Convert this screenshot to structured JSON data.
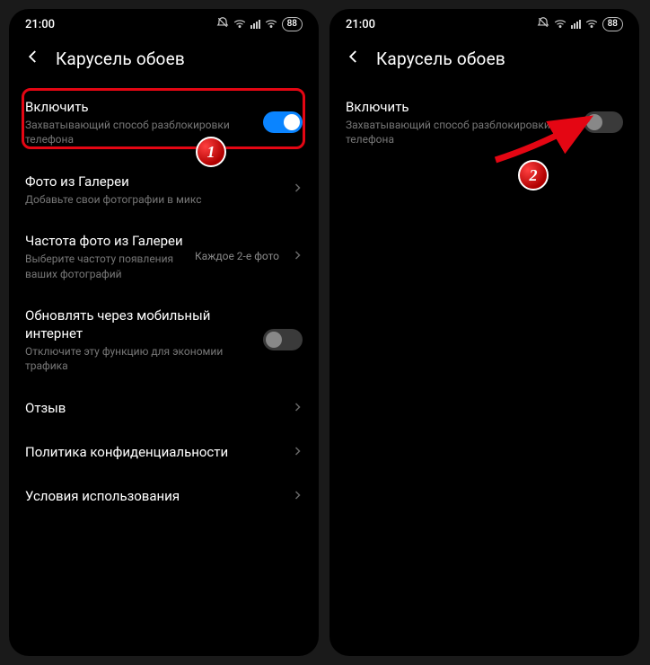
{
  "statusbar": {
    "time": "21:00",
    "battery": "88"
  },
  "header": {
    "title": "Карусель обоев"
  },
  "left": {
    "enable": {
      "title": "Включить",
      "sub": "Захватывающий способ разблокировки телефона"
    },
    "gallery": {
      "title": "Фото из Галереи",
      "sub": "Добавьте свои фотографии в микс"
    },
    "freq": {
      "title": "Частота фото из Галереи",
      "sub": "Выберите частоту появления ваших фотографий",
      "value": "Каждое 2-е фото"
    },
    "mobile": {
      "title": "Обновлять через мобильный интернет",
      "sub": "Отключите эту функцию для экономии трафика"
    },
    "review": {
      "title": "Отзыв"
    },
    "privacy": {
      "title": "Политика конфиденциальности"
    },
    "terms": {
      "title": "Условия использования"
    }
  },
  "right": {
    "enable": {
      "title": "Включить",
      "sub": "Захватывающий способ разблокировки телефона"
    }
  },
  "annotations": {
    "badge1": "1",
    "badge2": "2"
  }
}
